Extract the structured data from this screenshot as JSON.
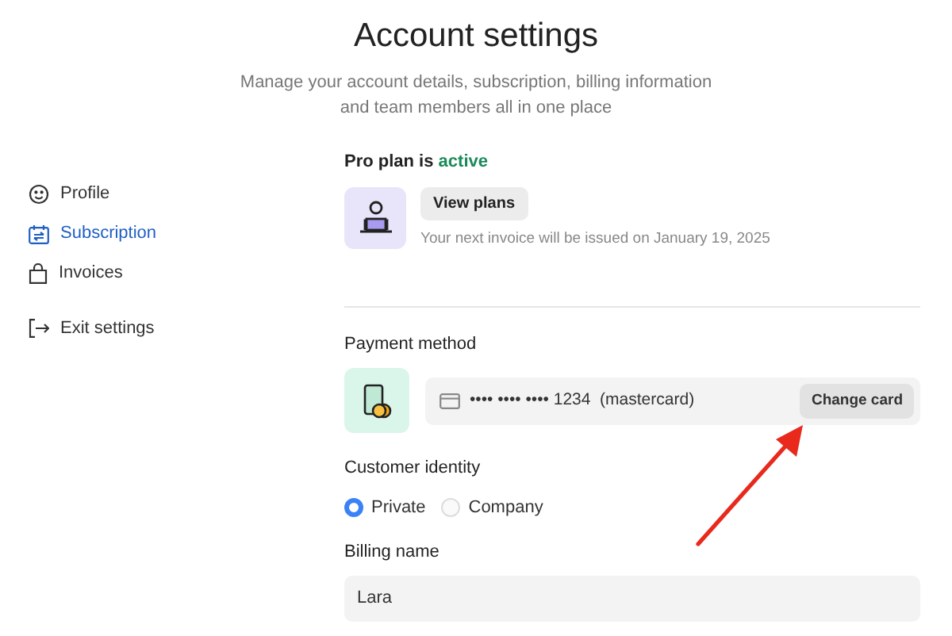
{
  "header": {
    "title": "Account settings",
    "subtitle": "Manage your account details, subscription, billing information and team members all in one place"
  },
  "sidebar": {
    "items": [
      {
        "label": "Profile",
        "selected": false
      },
      {
        "label": "Subscription",
        "selected": true
      },
      {
        "label": "Invoices",
        "selected": false
      }
    ],
    "exit": {
      "label": "Exit settings"
    }
  },
  "plan": {
    "heading": "Pro plan is **active**",
    "button": "View plans",
    "note": "Your next invoice will be issued on January 19, 2025"
  },
  "payment": {
    "heading": "Payment method",
    "card": "•••• •••• •••• 1234  (mastercard)",
    "button": "Change card"
  },
  "identity": {
    "heading": "Customer identity",
    "options": [
      {
        "label": "Private",
        "selected": true
      },
      {
        "label": "Company",
        "selected": false
      }
    ]
  },
  "billing_name": {
    "label": "Billing name",
    "value": "Lara"
  }
}
